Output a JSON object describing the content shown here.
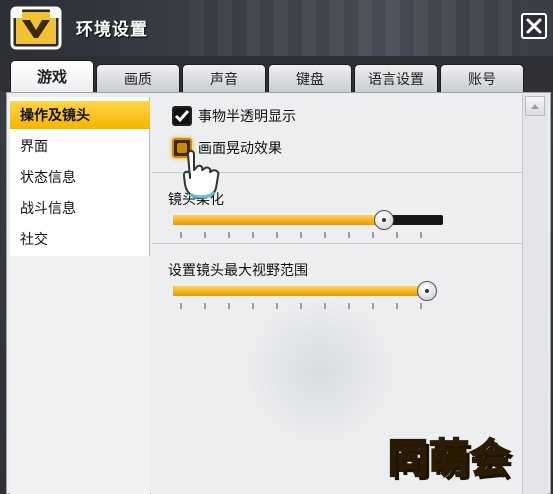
{
  "window": {
    "title": "环境设置"
  },
  "tabs": [
    {
      "label": "游戏",
      "active": true
    },
    {
      "label": "画质",
      "active": false
    },
    {
      "label": "声音",
      "active": false
    },
    {
      "label": "键盘",
      "active": false
    },
    {
      "label": "语言设置",
      "active": false
    },
    {
      "label": "账号",
      "active": false
    }
  ],
  "sidebar": {
    "items": [
      {
        "label": "操作及镜头",
        "active": true
      },
      {
        "label": "界面",
        "active": false
      },
      {
        "label": "状态信息",
        "active": false
      },
      {
        "label": "战斗信息",
        "active": false
      },
      {
        "label": "社交",
        "active": false
      }
    ]
  },
  "settings": {
    "translucent_objects": {
      "label": "事物半透明显示",
      "checked": true
    },
    "screen_shake": {
      "label": "画面晃动效果",
      "checked": false,
      "hovered": true
    },
    "camera_smoothing": {
      "label": "镜头柔化",
      "value_fraction": 0.78
    },
    "max_view_range": {
      "label": "设置镜头最大视野范围",
      "value_fraction": 1.0
    }
  },
  "watermark": {
    "text": "同萌会"
  },
  "colors": {
    "accent": "#f5b400",
    "slider_fill": "#e59a00",
    "titlebar": "#3b3f48"
  },
  "icons": {
    "close": "close-icon",
    "logo": "game-logo-icon",
    "cursor": "hand-pointer-icon",
    "scroll_up": "chevron-up-icon"
  }
}
